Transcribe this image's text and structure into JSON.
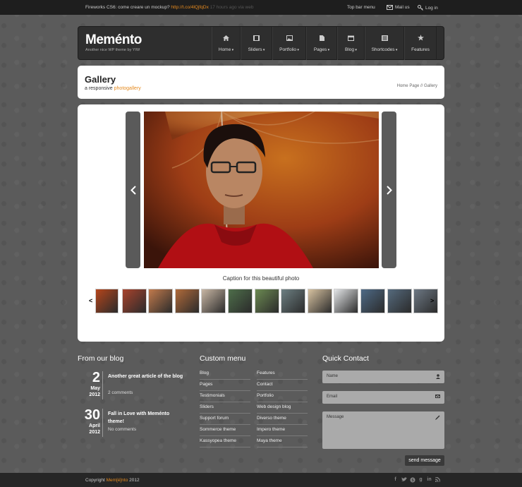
{
  "topbar": {
    "tweet_text": "Fireworks CS6: come creare un mockup?",
    "tweet_link": "http://t.co/4lQjfqDx",
    "tweet_trail": "17 hours ago via web",
    "menu_label": "Top bar menu",
    "mail_label": "Mail us",
    "login_label": "Log in"
  },
  "header": {
    "logo": "Meménto",
    "tagline": "Another nice WP theme by YIW",
    "nav": [
      {
        "label": "Home",
        "icon": "home-icon"
      },
      {
        "label": "Sliders",
        "icon": "film-icon"
      },
      {
        "label": "Portfolio",
        "icon": "image-icon"
      },
      {
        "label": "Pages",
        "icon": "page-icon"
      },
      {
        "label": "Blog",
        "icon": "calendar-icon"
      },
      {
        "label": "Shortcodes",
        "icon": "list-icon"
      },
      {
        "label": "Features",
        "icon": "star-icon"
      }
    ]
  },
  "page": {
    "title": "Gallery",
    "subtitle_pre": "a responsive ",
    "subtitle_accent": "photogallery",
    "breadcrumb": "Home Page // Gallery"
  },
  "gallery": {
    "caption": "Caption for this beautiful photo",
    "prev_label": "‹",
    "next_label": "›",
    "thumb_prev": "<",
    "thumb_next": ">",
    "thumbs": [
      "#b5451b",
      "#a8432d",
      "#c27a4c",
      "#b06a3a",
      "#c9b7a4",
      "#4e6e4a",
      "#6c8a52",
      "#6d7f82",
      "#d7c2a0",
      "#e4e6e8",
      "#4e6a86",
      "#556a7d",
      "#6d7884"
    ]
  },
  "blog": {
    "heading": "From our blog",
    "posts": [
      {
        "day": "2",
        "month": "May",
        "year": "2012",
        "title": "Another great article of the blog",
        "comments": "2 comments"
      },
      {
        "day": "30",
        "month": "April",
        "year": "2012",
        "title": "Fall in Love with Meménto theme!",
        "comments": "No comments"
      }
    ]
  },
  "custom_menu": {
    "heading": "Custom menu",
    "col1": [
      "Blog",
      "Pages",
      "Testimonials",
      "Sliders",
      "Support forum",
      "Sommerce theme",
      "Kassyopea theme"
    ],
    "col2": [
      "Features",
      "Contact",
      "Portfolio",
      "Web design blog",
      "Diverso theme",
      "Impero theme",
      "Maya theme"
    ]
  },
  "contact": {
    "heading": "Quick Contact",
    "name_placeholder": "Name",
    "email_placeholder": "Email",
    "message_placeholder": "Message",
    "send_label": "send message"
  },
  "footer": {
    "copy_pre": "Copyright ",
    "copy_brand": "Mem[é]nto",
    "copy_year": " 2012"
  },
  "colors": {
    "accent": "#e58a1e",
    "background": "#5b5b5b",
    "header": "#2e2e2e"
  }
}
